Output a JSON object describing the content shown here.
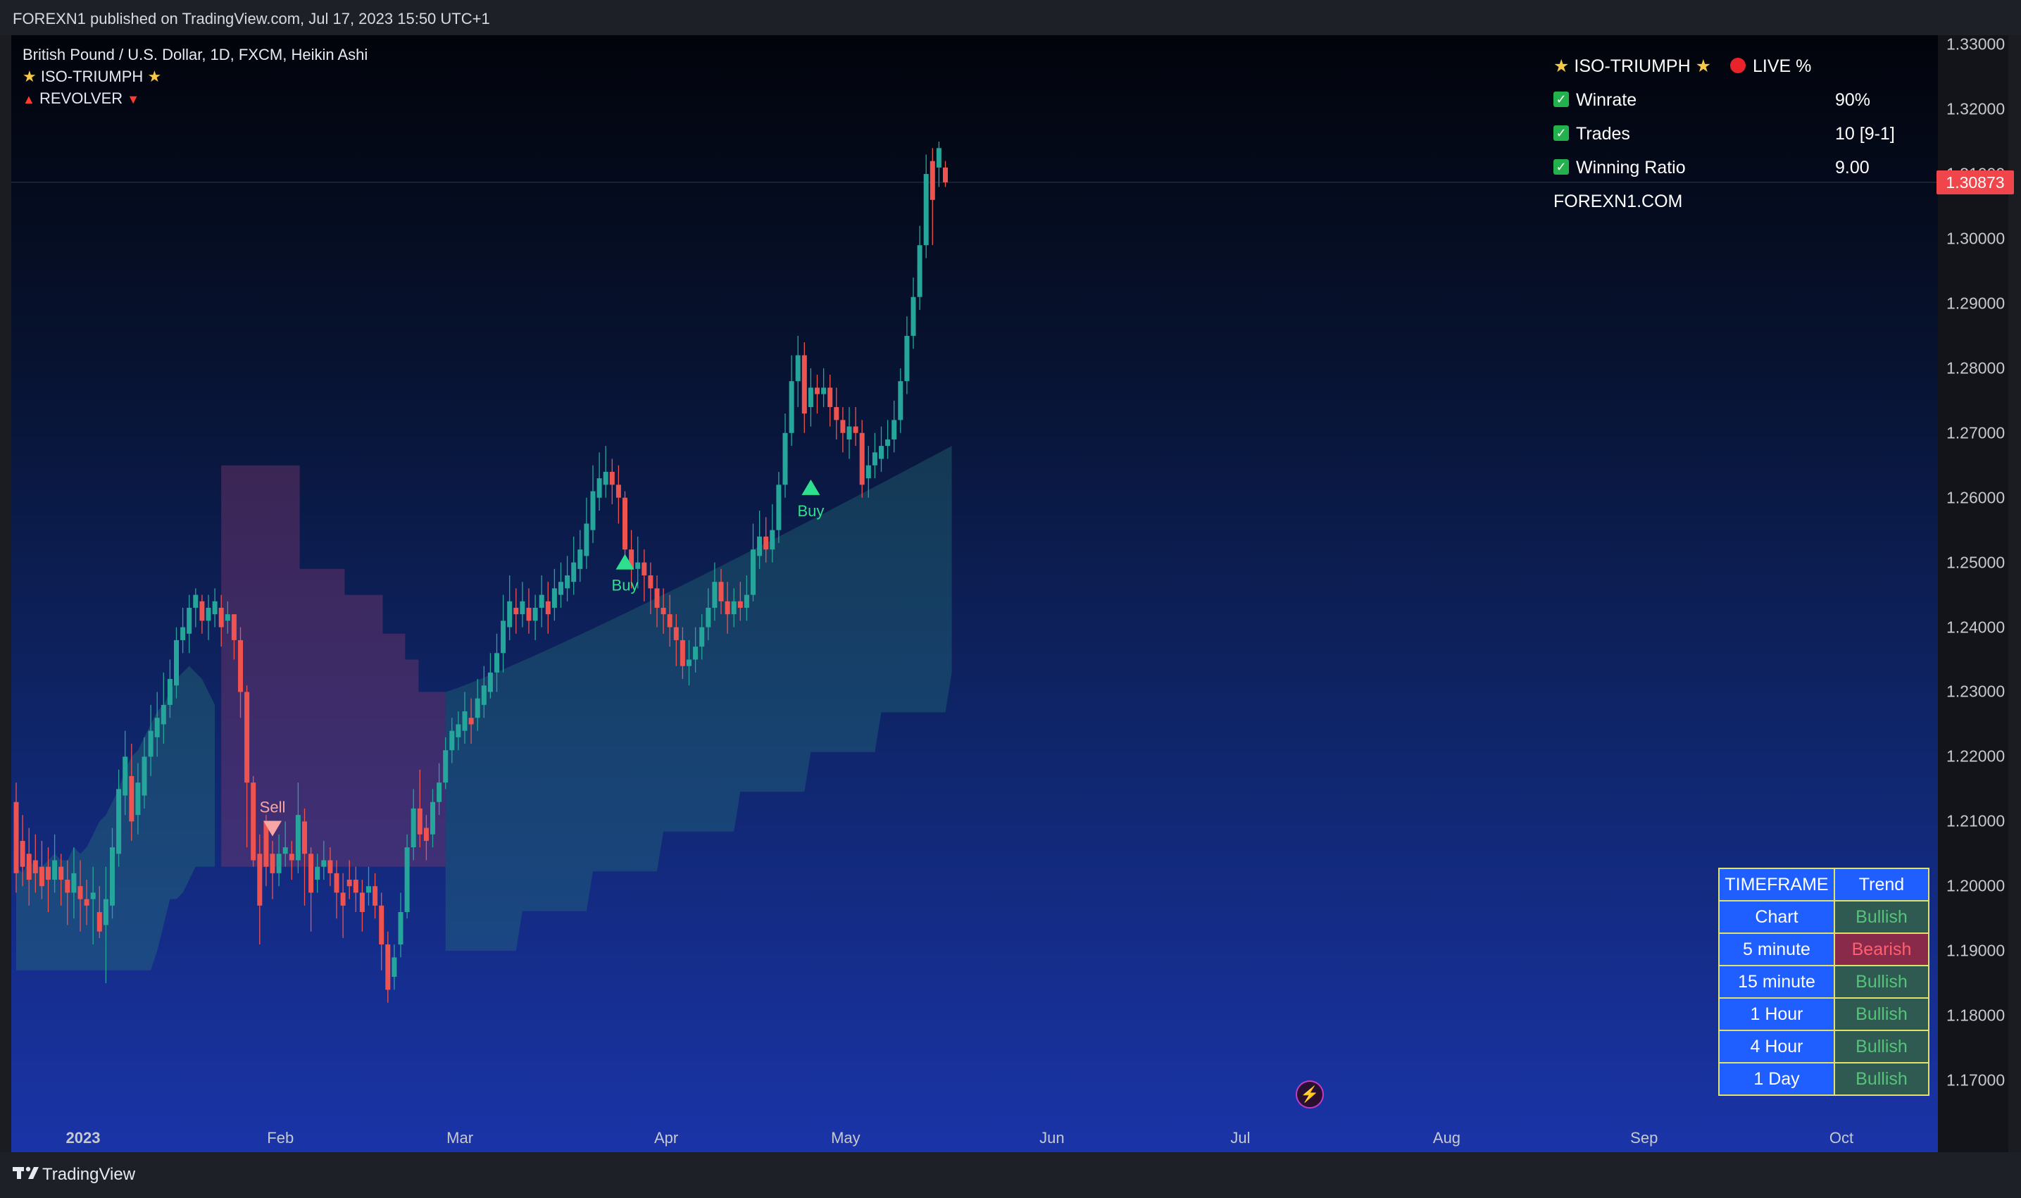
{
  "header": {
    "published": "FOREXN1 published on TradingView.com, Jul 17, 2023 15:50 UTC+1"
  },
  "legend": {
    "symbol_line": "British Pound / U.S. Dollar, 1D, FXCM, Heikin Ashi",
    "indicator_1": "ISO-TRIUMPH",
    "indicator_2": "REVOLVER"
  },
  "stats_panel": {
    "title": "ISO-TRIUMPH",
    "live_label": "LIVE %",
    "rows": [
      {
        "label": "Winrate",
        "value": "90%"
      },
      {
        "label": "Trades",
        "value": "10 [9-1]"
      },
      {
        "label": "Winning Ratio",
        "value": "9.00"
      }
    ],
    "site": "FOREXN1.COM"
  },
  "trend_table": {
    "headers": [
      "TIMEFRAME",
      "Trend"
    ],
    "rows": [
      {
        "timeframe": "Chart",
        "trend": "Bullish"
      },
      {
        "timeframe": "5 minute",
        "trend": "Bearish"
      },
      {
        "timeframe": "15 minute",
        "trend": "Bullish"
      },
      {
        "timeframe": "1 Hour",
        "trend": "Bullish"
      },
      {
        "timeframe": "4 Hour",
        "trend": "Bullish"
      },
      {
        "timeframe": "1 Day",
        "trend": "Bullish"
      }
    ]
  },
  "chart_data": {
    "type": "candlestick",
    "style": "Heikin Ashi",
    "symbol": "British Pound / U.S. Dollar",
    "interval": "1D",
    "source": "FXCM",
    "ylim": [
      1.165,
      1.331
    ],
    "y_ticks": [
      "1.33000",
      "1.32000",
      "1.31000",
      "1.30000",
      "1.29000",
      "1.28000",
      "1.27000",
      "1.26000",
      "1.25000",
      "1.24000",
      "1.23000",
      "1.22000",
      "1.21000",
      "1.20000",
      "1.19000",
      "1.18000",
      "1.17000"
    ],
    "last_price": "1.30873",
    "x_labels": [
      {
        "label": "2023",
        "bold": true
      },
      {
        "label": "Feb"
      },
      {
        "label": "Mar"
      },
      {
        "label": "Apr"
      },
      {
        "label": "May"
      },
      {
        "label": "Jun"
      },
      {
        "label": "Jul"
      },
      {
        "label": "Aug"
      },
      {
        "label": "Sep"
      },
      {
        "label": "Oct"
      }
    ],
    "bars_per_month": 22,
    "label_day_offsets": [
      0,
      22,
      42,
      65,
      85,
      108,
      129,
      152,
      174,
      196
    ],
    "candles": [
      [
        1.213,
        1.202,
        1.216,
        1.199
      ],
      [
        1.207,
        1.203,
        1.211,
        1.2
      ],
      [
        1.205,
        1.201,
        1.209,
        1.197
      ],
      [
        1.204,
        1.202,
        1.208,
        1.199
      ],
      [
        1.203,
        1.2,
        1.207,
        1.198
      ],
      [
        1.203,
        1.201,
        1.206,
        1.196
      ],
      [
        1.201,
        1.204,
        1.208,
        1.199
      ],
      [
        1.203,
        1.201,
        1.205,
        1.197
      ],
      [
        1.201,
        1.199,
        1.204,
        1.194
      ],
      [
        1.199,
        1.202,
        1.206,
        1.195
      ],
      [
        1.2,
        1.198,
        1.204,
        1.193
      ],
      [
        1.198,
        1.197,
        1.201,
        1.194
      ],
      [
        1.198,
        1.199,
        1.203,
        1.191
      ],
      [
        1.196,
        1.193,
        1.2,
        1.192
      ],
      [
        1.194,
        1.198,
        1.203,
        1.185
      ],
      [
        1.197,
        1.206,
        1.209,
        1.195
      ],
      [
        1.205,
        1.215,
        1.218,
        1.203
      ],
      [
        1.214,
        1.22,
        1.224,
        1.211
      ],
      [
        1.217,
        1.21,
        1.222,
        1.207
      ],
      [
        1.211,
        1.216,
        1.219,
        1.208
      ],
      [
        1.214,
        1.22,
        1.223,
        1.212
      ],
      [
        1.22,
        1.224,
        1.228,
        1.217
      ],
      [
        1.223,
        1.226,
        1.23,
        1.22
      ],
      [
        1.225,
        1.228,
        1.233,
        1.222
      ],
      [
        1.228,
        1.232,
        1.235,
        1.226
      ],
      [
        1.231,
        1.238,
        1.24,
        1.229
      ],
      [
        1.238,
        1.24,
        1.243,
        1.236
      ],
      [
        1.239,
        1.243,
        1.245,
        1.236
      ],
      [
        1.243,
        1.245,
        1.246,
        1.24
      ],
      [
        1.244,
        1.241,
        1.245,
        1.239
      ],
      [
        1.241,
        1.243,
        1.245,
        1.238
      ],
      [
        1.242,
        1.244,
        1.246,
        1.24
      ],
      [
        1.243,
        1.24,
        1.245,
        1.237
      ],
      [
        1.241,
        1.242,
        1.244,
        1.239
      ],
      [
        1.242,
        1.238,
        1.242,
        1.235
      ],
      [
        1.238,
        1.23,
        1.24,
        1.226
      ],
      [
        1.23,
        1.216,
        1.231,
        1.206
      ],
      [
        1.216,
        1.204,
        1.217,
        1.203
      ],
      [
        1.205,
        1.197,
        1.208,
        1.191
      ],
      [
        1.21,
        1.203,
        1.211,
        1.2
      ],
      [
        1.205,
        1.202,
        1.207,
        1.198
      ],
      [
        1.202,
        1.205,
        1.208,
        1.2
      ],
      [
        1.205,
        1.206,
        1.21,
        1.203
      ],
      [
        1.205,
        1.204,
        1.207,
        1.201
      ],
      [
        1.204,
        1.211,
        1.216,
        1.202
      ],
      [
        1.21,
        1.205,
        1.212,
        1.197
      ],
      [
        1.205,
        1.199,
        1.206,
        1.193
      ],
      [
        1.201,
        1.203,
        1.205,
        1.199
      ],
      [
        1.203,
        1.204,
        1.207,
        1.201
      ],
      [
        1.204,
        1.202,
        1.206,
        1.2
      ],
      [
        1.202,
        1.199,
        1.204,
        1.195
      ],
      [
        1.199,
        1.197,
        1.202,
        1.192
      ],
      [
        1.201,
        1.2,
        1.204,
        1.198
      ],
      [
        1.201,
        1.199,
        1.203,
        1.196
      ],
      [
        1.199,
        1.196,
        1.201,
        1.193
      ],
      [
        1.199,
        1.2,
        1.203,
        1.197
      ],
      [
        1.2,
        1.197,
        1.202,
        1.195
      ],
      [
        1.197,
        1.191,
        1.199,
        1.187
      ],
      [
        1.191,
        1.184,
        1.193,
        1.182
      ],
      [
        1.186,
        1.189,
        1.191,
        1.184
      ],
      [
        1.191,
        1.196,
        1.199,
        1.189
      ],
      [
        1.196,
        1.206,
        1.208,
        1.195
      ],
      [
        1.206,
        1.212,
        1.215,
        1.204
      ],
      [
        1.212,
        1.208,
        1.218,
        1.206
      ],
      [
        1.209,
        1.207,
        1.211,
        1.204
      ],
      [
        1.208,
        1.213,
        1.215,
        1.206
      ],
      [
        1.213,
        1.216,
        1.219,
        1.211
      ],
      [
        1.216,
        1.221,
        1.223,
        1.215
      ],
      [
        1.221,
        1.224,
        1.226,
        1.219
      ],
      [
        1.223,
        1.225,
        1.227,
        1.221
      ],
      [
        1.224,
        1.227,
        1.23,
        1.222
      ],
      [
        1.226,
        1.225,
        1.229,
        1.222
      ],
      [
        1.226,
        1.229,
        1.232,
        1.224
      ],
      [
        1.228,
        1.231,
        1.234,
        1.226
      ],
      [
        1.23,
        1.233,
        1.236,
        1.229
      ],
      [
        1.233,
        1.236,
        1.239,
        1.23
      ],
      [
        1.236,
        1.241,
        1.245,
        1.233
      ],
      [
        1.24,
        1.244,
        1.248,
        1.238
      ],
      [
        1.243,
        1.242,
        1.246,
        1.239
      ],
      [
        1.242,
        1.244,
        1.247,
        1.24
      ],
      [
        1.243,
        1.241,
        1.246,
        1.239
      ],
      [
        1.241,
        1.243,
        1.245,
        1.238
      ],
      [
        1.243,
        1.245,
        1.248,
        1.24
      ],
      [
        1.244,
        1.242,
        1.247,
        1.239
      ],
      [
        1.243,
        1.246,
        1.249,
        1.241
      ],
      [
        1.245,
        1.247,
        1.25,
        1.243
      ],
      [
        1.246,
        1.248,
        1.251,
        1.244
      ],
      [
        1.247,
        1.25,
        1.254,
        1.245
      ],
      [
        1.249,
        1.252,
        1.255,
        1.247
      ],
      [
        1.251,
        1.256,
        1.26,
        1.249
      ],
      [
        1.255,
        1.261,
        1.265,
        1.253
      ],
      [
        1.26,
        1.263,
        1.267,
        1.258
      ],
      [
        1.262,
        1.264,
        1.268,
        1.26
      ],
      [
        1.264,
        1.262,
        1.266,
        1.259
      ],
      [
        1.262,
        1.26,
        1.265,
        1.256
      ],
      [
        1.26,
        1.252,
        1.261,
        1.249
      ],
      [
        1.252,
        1.249,
        1.255,
        1.246
      ],
      [
        1.249,
        1.25,
        1.254,
        1.246
      ],
      [
        1.25,
        1.248,
        1.252,
        1.244
      ],
      [
        1.248,
        1.246,
        1.25,
        1.242
      ],
      [
        1.246,
        1.243,
        1.248,
        1.24
      ],
      [
        1.243,
        1.242,
        1.246,
        1.239
      ],
      [
        1.242,
        1.24,
        1.245,
        1.237
      ],
      [
        1.24,
        1.238,
        1.242,
        1.234
      ],
      [
        1.238,
        1.234,
        1.24,
        1.232
      ],
      [
        1.234,
        1.235,
        1.238,
        1.231
      ],
      [
        1.235,
        1.237,
        1.24,
        1.233
      ],
      [
        1.237,
        1.24,
        1.242,
        1.235
      ],
      [
        1.24,
        1.243,
        1.246,
        1.238
      ],
      [
        1.243,
        1.247,
        1.25,
        1.241
      ],
      [
        1.247,
        1.244,
        1.249,
        1.242
      ],
      [
        1.244,
        1.242,
        1.247,
        1.239
      ],
      [
        1.242,
        1.244,
        1.246,
        1.24
      ],
      [
        1.244,
        1.243,
        1.247,
        1.241
      ],
      [
        1.243,
        1.245,
        1.248,
        1.241
      ],
      [
        1.245,
        1.252,
        1.256,
        1.244
      ],
      [
        1.251,
        1.254,
        1.258,
        1.249
      ],
      [
        1.254,
        1.252,
        1.257,
        1.25
      ],
      [
        1.252,
        1.255,
        1.259,
        1.25
      ],
      [
        1.255,
        1.262,
        1.264,
        1.253
      ],
      [
        1.262,
        1.27,
        1.273,
        1.26
      ],
      [
        1.27,
        1.278,
        1.282,
        1.268
      ],
      [
        1.278,
        1.282,
        1.285,
        1.274
      ],
      [
        1.282,
        1.273,
        1.284,
        1.27
      ],
      [
        1.274,
        1.277,
        1.28,
        1.271
      ],
      [
        1.277,
        1.276,
        1.279,
        1.273
      ],
      [
        1.276,
        1.277,
        1.28,
        1.274
      ],
      [
        1.277,
        1.274,
        1.279,
        1.271
      ],
      [
        1.274,
        1.272,
        1.277,
        1.269
      ],
      [
        1.272,
        1.27,
        1.274,
        1.267
      ],
      [
        1.269,
        1.271,
        1.274,
        1.266
      ],
      [
        1.271,
        1.27,
        1.274,
        1.268
      ],
      [
        1.27,
        1.262,
        1.272,
        1.26
      ],
      [
        1.263,
        1.265,
        1.268,
        1.26
      ],
      [
        1.265,
        1.267,
        1.27,
        1.263
      ],
      [
        1.266,
        1.268,
        1.271,
        1.264
      ],
      [
        1.268,
        1.269,
        1.272,
        1.266
      ],
      [
        1.269,
        1.272,
        1.275,
        1.267
      ],
      [
        1.272,
        1.278,
        1.28,
        1.27
      ],
      [
        1.278,
        1.285,
        1.288,
        1.276
      ],
      [
        1.285,
        1.291,
        1.294,
        1.283
      ],
      [
        1.291,
        1.299,
        1.302,
        1.289
      ],
      [
        1.299,
        1.31,
        1.313,
        1.297
      ],
      [
        1.312,
        1.306,
        1.314,
        1.299
      ],
      [
        1.311,
        1.314,
        1.315,
        1.308
      ],
      [
        1.311,
        1.3087,
        1.312,
        1.308
      ]
    ],
    "signals": [
      {
        "label": "Sell",
        "direction": "down",
        "bar": 40,
        "price": 1.209
      },
      {
        "label": "Buy",
        "direction": "up",
        "bar": 95,
        "price": 1.25
      },
      {
        "label": "Buy",
        "direction": "up",
        "bar": 124,
        "price": 1.2615
      }
    ],
    "band": {
      "bullish_segment_1": {
        "start_bar": 0,
        "end_bar": 32,
        "top": [
          1.203,
          1.202,
          1.204,
          1.203,
          1.203,
          1.204,
          1.205,
          1.204,
          1.204,
          1.206,
          1.205,
          1.206,
          1.208,
          1.21,
          1.211,
          1.213,
          1.215,
          1.218,
          1.22,
          1.221,
          1.223,
          1.225,
          1.227,
          1.228,
          1.23,
          1.232,
          1.233,
          1.234,
          1.233,
          1.232,
          1.23,
          1.228
        ],
        "bottom": [
          1.187,
          1.187,
          1.187,
          1.187,
          1.187,
          1.187,
          1.187,
          1.187,
          1.187,
          1.187,
          1.187,
          1.187,
          1.187,
          1.187,
          1.187,
          1.187,
          1.187,
          1.187,
          1.187,
          1.187,
          1.187,
          1.187,
          1.19,
          1.194,
          1.198,
          1.198,
          1.199,
          1.201,
          1.203,
          1.203,
          1.203,
          1.203
        ]
      },
      "bearish_segment": {
        "start_bar": 32,
        "end_bar": 67,
        "top": 1.265,
        "bottom": 1.203
      },
      "bullish_segment_2": {
        "start_bar": 67,
        "end_bar": 146,
        "bottom_start": 1.19,
        "bottom_end": 1.233,
        "top_start": 1.23,
        "top_end": 1.268
      }
    }
  }
}
